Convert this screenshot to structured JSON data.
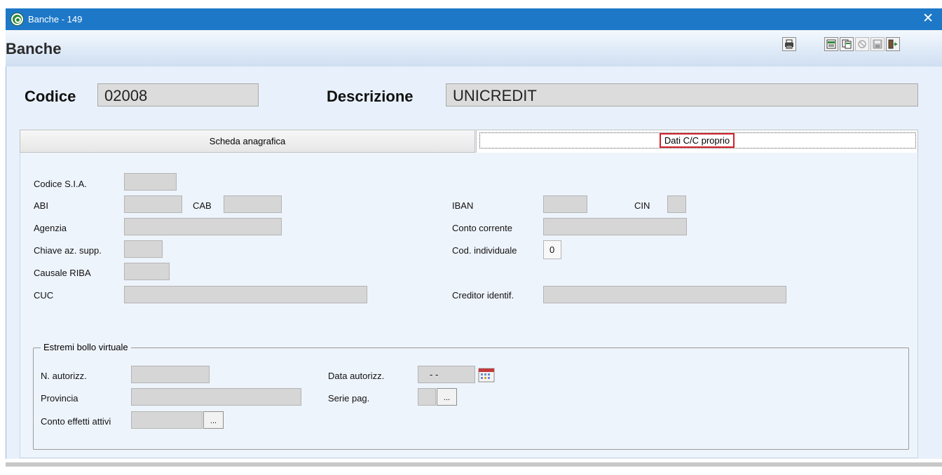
{
  "window": {
    "title": "Banche - 149"
  },
  "form": {
    "title": "Banche"
  },
  "header_fields": {
    "codice_label": "Codice",
    "codice_value": "02008",
    "descrizione_label": "Descrizione",
    "descrizione_value": "UNICREDIT"
  },
  "tabs": [
    {
      "label": "Scheda anagrafica",
      "active": false
    },
    {
      "label": "Dati C/C proprio",
      "active": true
    }
  ],
  "fields": {
    "codice_sia": {
      "label": "Codice S.I.A.",
      "value": ""
    },
    "abi": {
      "label": "ABI",
      "value": ""
    },
    "cab": {
      "label": "CAB",
      "value": ""
    },
    "agenzia": {
      "label": "Agenzia",
      "value": ""
    },
    "chiave_az_supp": {
      "label": "Chiave az. supp.",
      "value": ""
    },
    "causale_riba": {
      "label": "Causale RIBA",
      "value": ""
    },
    "cuc": {
      "label": "CUC",
      "value": ""
    },
    "iban": {
      "label": "IBAN",
      "value": ""
    },
    "cin": {
      "label": "CIN",
      "value": ""
    },
    "conto_corrente": {
      "label": "Conto corrente",
      "value": ""
    },
    "cod_individuale": {
      "label": "Cod. individuale",
      "value": "0"
    },
    "creditor_identif": {
      "label": "Creditor identif.",
      "value": ""
    }
  },
  "bollo": {
    "legend": "Estremi bollo virtuale",
    "n_autorizz": {
      "label": "N. autorizz.",
      "value": ""
    },
    "provincia": {
      "label": "Provincia",
      "value": ""
    },
    "conto_effetti_attivi": {
      "label": "Conto effetti attivi",
      "value": ""
    },
    "data_autorizz": {
      "label": "Data autorizz.",
      "value": "- -"
    },
    "serie_pag": {
      "label": "Serie pag.",
      "value": ""
    },
    "browse_label": "..."
  },
  "toolbar": {
    "icons": [
      "print-icon",
      "export-icon",
      "copy-icon",
      "delete-icon",
      "save-icon",
      "exit-icon"
    ]
  },
  "colors": {
    "titlebar": "#1e78c8",
    "active_tab_highlight": "#d0212b",
    "panel": "#e8f1fb"
  }
}
